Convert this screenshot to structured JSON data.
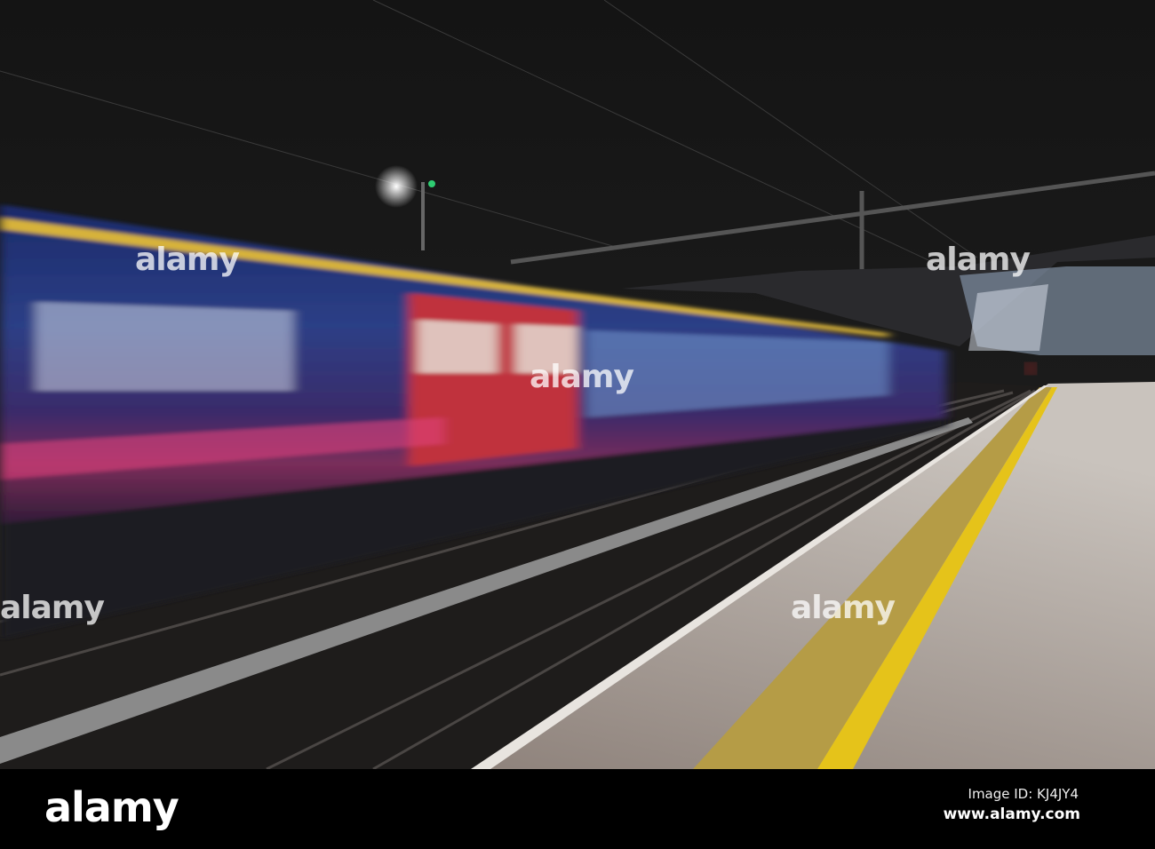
{
  "photo": {
    "subject": "motion-blurred train passing station platform at night",
    "colors": {
      "sky": "#151515",
      "train_blue": "#1c2f6e",
      "train_red": "#b0303a",
      "platform": "#a49a93",
      "tactile_yellow": "#b49a3e",
      "edge_yellow": "#e3c21c"
    }
  },
  "watermark": {
    "text": "alamy"
  },
  "footer": {
    "logo": "alamy",
    "image_id": "Image ID: KJ4JY4",
    "url": "www.alamy.com"
  }
}
